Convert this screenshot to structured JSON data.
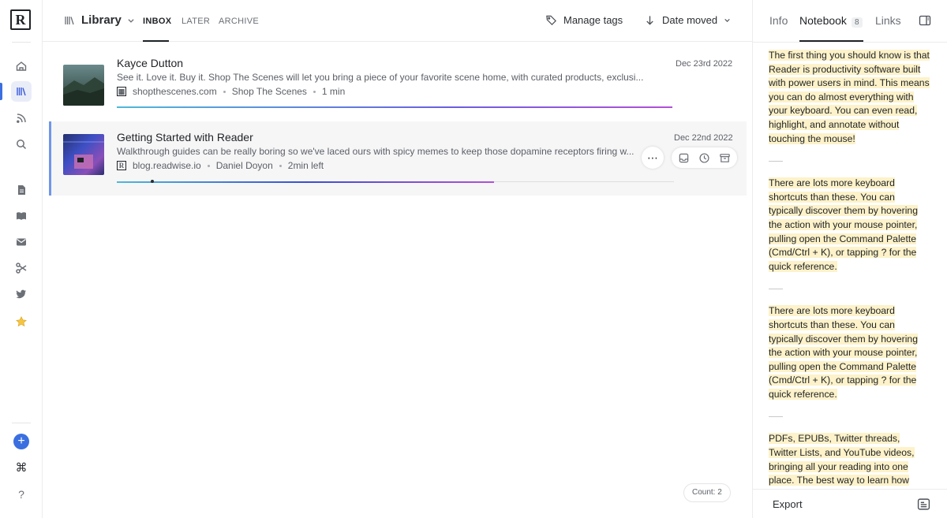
{
  "app": {
    "logo_letter": "R"
  },
  "rail": {
    "items": [
      {
        "name": "home",
        "icon": "home-icon"
      },
      {
        "name": "library",
        "icon": "library-icon",
        "active": true
      },
      {
        "name": "feed",
        "icon": "rss-icon"
      },
      {
        "name": "search",
        "icon": "search-icon"
      },
      {
        "name": "articles",
        "icon": "document-icon"
      },
      {
        "name": "books",
        "icon": "book-icon"
      },
      {
        "name": "emails",
        "icon": "mail-icon"
      },
      {
        "name": "highlights",
        "icon": "scissors-icon"
      },
      {
        "name": "twitter",
        "icon": "twitter-icon"
      },
      {
        "name": "shortlist",
        "icon": "star-icon"
      }
    ],
    "bottom": {
      "add": "+",
      "command": "⌘",
      "help": "?"
    }
  },
  "header": {
    "library_label": "Library",
    "tabs": [
      {
        "label": "INBOX",
        "active": true
      },
      {
        "label": "LATER"
      },
      {
        "label": "ARCHIVE"
      }
    ],
    "manage_tags": "Manage tags",
    "sort_label": "Date moved"
  },
  "documents": [
    {
      "title": "Kayce Dutton",
      "description": "See it. Love it. Buy it. Shop The Scenes will let you bring a piece of your favorite scene home, with curated products, exclusi...",
      "domain": "shopthescenes.com",
      "author": "Shop The Scenes",
      "reading_time": "1 min",
      "date": "Dec 23rd 2022",
      "selected": false
    },
    {
      "title": "Getting Started with Reader",
      "description": "Walkthrough guides can be really boring so we've laced ours with spicy memes to keep those dopamine receptors firing w...",
      "domain": "blog.readwise.io",
      "author": "Daniel Doyon",
      "reading_time": "2min left",
      "date": "Dec 22nd 2022",
      "selected": true,
      "progress": 0.07
    }
  ],
  "count_label": "Count: 2",
  "sidebar": {
    "tabs": [
      {
        "label": "Info"
      },
      {
        "label": "Notebook",
        "badge": "8",
        "active": true
      },
      {
        "label": "Links"
      }
    ],
    "highlights": [
      "The first thing you should know is that Reader is productivity software built with power users in mind. This means you can do almost everything with your keyboard. You can even read, highlight, and annotate without touching the mouse!",
      "There are lots more keyboard shortcuts than these. You can typically discover them by hovering the action with your mouse pointer, pulling open the Command Palette (Cmd/Ctrl + K), or tapping ? for the quick reference.",
      "There are lots more keyboard shortcuts than these. You can typically discover them by hovering the action with your mouse pointer, pulling open the Command Palette (Cmd/Ctrl + K), or tapping ? for the quick reference.",
      "PDFs, EPUBs, Twitter threads, Twitter Lists, and YouTube videos, bringing all your reading into one place. The best way to learn how"
    ],
    "export_label": "Export"
  }
}
